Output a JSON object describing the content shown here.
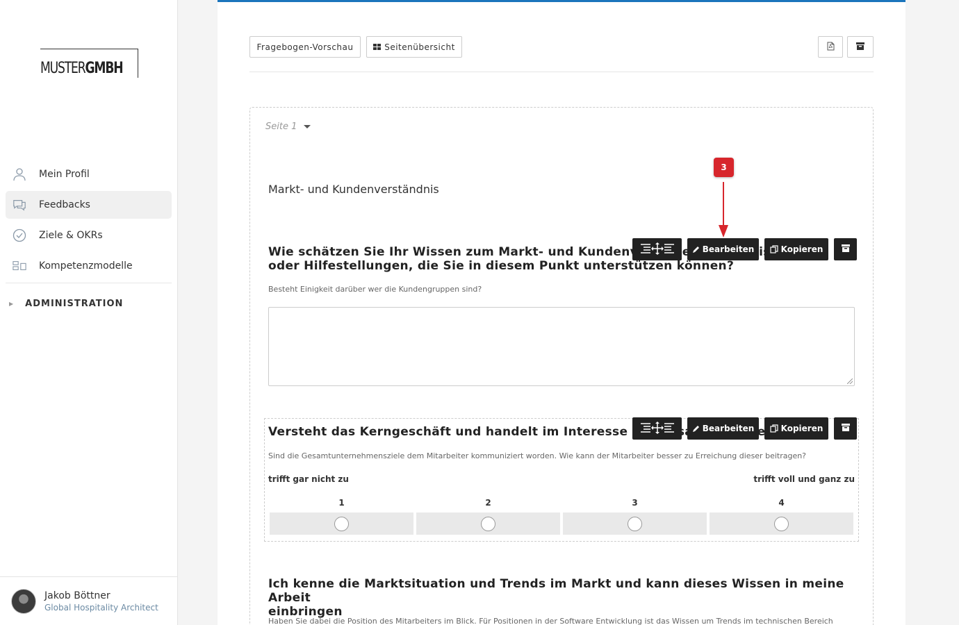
{
  "sidebar": {
    "logo": {
      "part1": "MUSTER",
      "part2": "GMBH"
    },
    "items": [
      {
        "label": "Mein Profil",
        "icon": "user-icon"
      },
      {
        "label": "Feedbacks",
        "icon": "chat-icon"
      },
      {
        "label": "Ziele & OKRs",
        "icon": "check-circle-icon"
      },
      {
        "label": "Kompetenzmodelle",
        "icon": "blocks-icon"
      }
    ],
    "admin_label": "ADMINISTRATION",
    "user": {
      "name": "Jakob Böttner",
      "role": "Global Hospitality Architect"
    }
  },
  "toolbar": {
    "preview_label": "Fragebogen-Vorschau",
    "overview_label": "Seitenübersicht"
  },
  "page": {
    "label": "Seite 1",
    "section_title": "Markt- und Kundenverständnis"
  },
  "actions": {
    "edit_label": "Bearbeiten",
    "copy_label": "Kopieren"
  },
  "annotation": {
    "badge": "3",
    "color": "#d7262c"
  },
  "questions": [
    {
      "title_line1": "Wie schätzen Sie Ihr Wissen zum Markt- und Kundenverst",
      "title_after": "ebenen Sie Wissen",
      "title_line2": "oder Hilfestellungen, die Sie in diesem Punkt unterstützen können?",
      "description": "Besteht Einigkeit darüber wer die Kundengruppen sind?"
    },
    {
      "title": "Versteht das Kerngeschäft und handelt im Interesse der G",
      "title_tail": "esamtunternehmens",
      "description": "Sind die Gesamtunternehmensziele dem Mitarbeiter kommuniziert worden. Wie kann der Mitarbeiter besser zu Erreichung dieser beitragen?",
      "scale_min_label": "trifft gar nicht zu",
      "scale_max_label": "trifft voll und ganz zu",
      "scale": [
        "1",
        "2",
        "3",
        "4"
      ]
    },
    {
      "title_line1": "Ich kenne die Marktsituation und Trends im Markt und kann dieses Wissen in meine Arbeit",
      "title_line2": "einbringen",
      "description": "Haben Sie dabei die Position des Mitarbeiters im Blick. Für Positionen in der Software Entwicklung ist das Wissen um Trends im technischen Bereich"
    }
  ],
  "colors": {
    "accent": "#1b75bc",
    "toolbar_dark": "#222222"
  }
}
